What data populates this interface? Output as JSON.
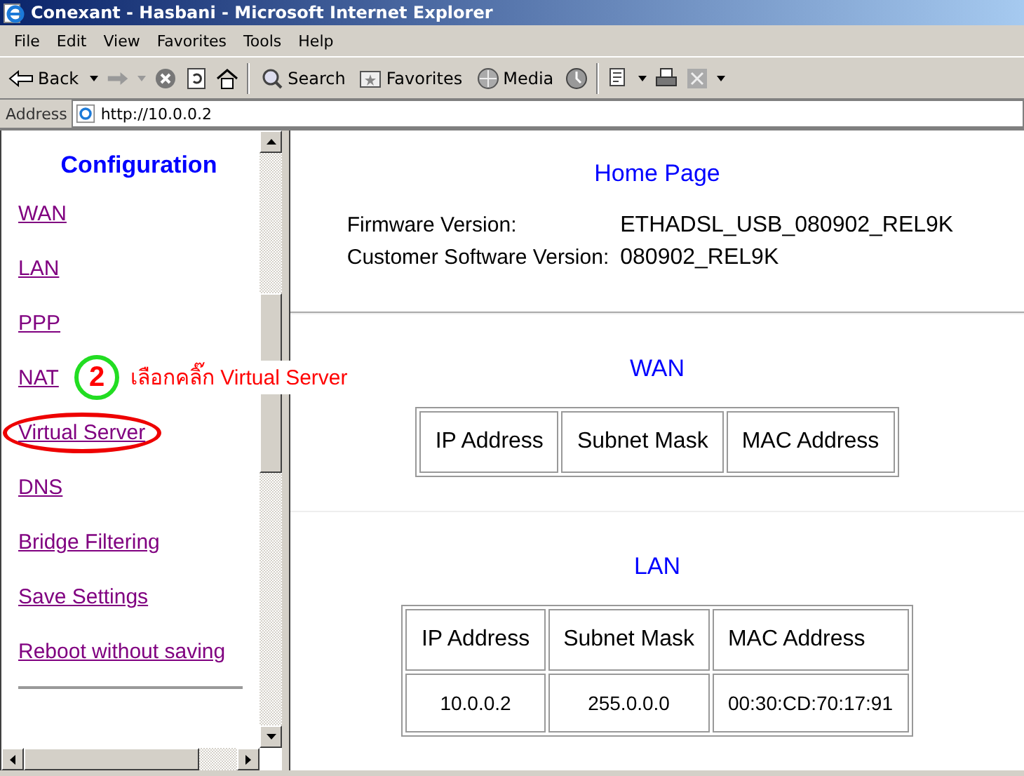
{
  "window": {
    "title": "Conexant - Hasbani - Microsoft Internet Explorer"
  },
  "menu": [
    "File",
    "Edit",
    "View",
    "Favorites",
    "Tools",
    "Help"
  ],
  "toolbar": {
    "back": "Back",
    "search": "Search",
    "favorites": "Favorites",
    "media": "Media"
  },
  "address_bar": {
    "label": "Address",
    "url": "http://10.0.0.2"
  },
  "sidebar": {
    "title": "Configuration",
    "links": [
      {
        "label": "WAN",
        "highlighted": false
      },
      {
        "label": "LAN",
        "highlighted": false
      },
      {
        "label": "PPP",
        "highlighted": false
      },
      {
        "label": "NAT",
        "highlighted": false
      },
      {
        "label": "Virtual Server",
        "highlighted": true
      },
      {
        "label": "DNS",
        "highlighted": false
      },
      {
        "label": "Bridge Filtering",
        "highlighted": false
      },
      {
        "label": "Save Settings",
        "highlighted": false
      },
      {
        "label": "Reboot without saving",
        "highlighted": false
      }
    ]
  },
  "annotation": {
    "step": "2",
    "text": "เลือกคลิ๊ก Virtual Server"
  },
  "main": {
    "heading": "Home Page",
    "info": [
      {
        "label": "Firmware Version:",
        "value": "ETHADSL_USB_080902_REL9K"
      },
      {
        "label": "Customer Software Version:",
        "value": "080902_REL9K"
      }
    ],
    "sections": [
      {
        "title": "WAN",
        "columns": [
          "IP Address",
          "Subnet Mask",
          "MAC Address"
        ]
      },
      {
        "title": "LAN",
        "columns": [
          "IP Address",
          "Subnet Mask",
          "MAC Address"
        ],
        "rows": [
          [
            "10.0.0.2",
            "255.0.0.0",
            "00:30:CD:70:17:91"
          ]
        ]
      }
    ]
  }
}
